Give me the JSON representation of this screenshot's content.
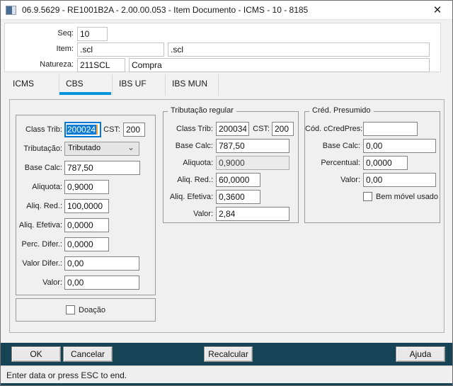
{
  "window": {
    "title": "06.9.5629 - RE1001B2A - 2.00.00.053 - Item Documento - ICMS - 10 - 8185",
    "close_glyph": "✕"
  },
  "header": {
    "seq_label": "Seq:",
    "seq_value": "10",
    "item_label": "Item:",
    "item_code": ".scl",
    "item_desc": ".scl",
    "natureza_label": "Natureza:",
    "natureza_code": "211SCL",
    "natureza_desc": "Compra"
  },
  "tabs": {
    "icms": "ICMS",
    "cbs": "CBS",
    "ibs_uf": "IBS UF",
    "ibs_mun": "IBS MUN"
  },
  "cbs": {
    "class_trib_label": "Class Trib:",
    "class_trib_value": "200024",
    "cst_label": "CST:",
    "cst_value": "200",
    "tributacao_label": "Tributação:",
    "tributacao_value": "Tributado",
    "base_calc_label": "Base Calc:",
    "base_calc_value": "787,50",
    "aliquota_label": "Aliquota:",
    "aliquota_value": "0,9000",
    "aliq_red_label": "Aliq. Red.:",
    "aliq_red_value": "100,0000",
    "aliq_efetiva_label": "Aliq. Efetiva:",
    "aliq_efetiva_value": "0,0000",
    "perc_difer_label": "Perc. Difer.:",
    "perc_difer_value": "0,0000",
    "valor_difer_label": "Valor Difer.:",
    "valor_difer_value": "0,00",
    "valor_label": "Valor:",
    "valor_value": "0,00",
    "doacao_label": "Doação"
  },
  "regular": {
    "title": "Tributação regular",
    "class_trib_label": "Class Trib:",
    "class_trib_value": "200034",
    "cst_label": "CST:",
    "cst_value": "200",
    "base_calc_label": "Base Calc:",
    "base_calc_value": "787,50",
    "aliquota_label": "Aliquota:",
    "aliquota_value": "0,9000",
    "aliq_red_label": "Aliq. Red.:",
    "aliq_red_value": "60,0000",
    "aliq_efetiva_label": "Aliq. Efetiva:",
    "aliq_efetiva_value": "0,3600",
    "valor_label": "Valor:",
    "valor_value": "2,84"
  },
  "cred_presumido": {
    "title": "Créd. Presumido",
    "cod_label": "Cód. cCredPres:",
    "cod_value": "",
    "base_calc_label": "Base Calc:",
    "base_calc_value": "0,00",
    "percentual_label": "Percentual:",
    "percentual_value": "0,0000",
    "valor_label": "Valor:",
    "valor_value": "0,00",
    "bem_movel_label": "Bem móvel usado"
  },
  "buttons": {
    "ok": "OK",
    "cancel": "Cancelar",
    "recalc": "Recalcular",
    "help": "Ajuda"
  },
  "statusbar": {
    "text": "Enter data or press ESC to end."
  },
  "combo_chevron": "⌄",
  "colors": {
    "tab_accent": "#0095dd",
    "focus_blue": "#0078d7",
    "selection_blue": "#0c7cd5",
    "caret_orange": "#ff9c42",
    "bar_teal": "#164456"
  }
}
